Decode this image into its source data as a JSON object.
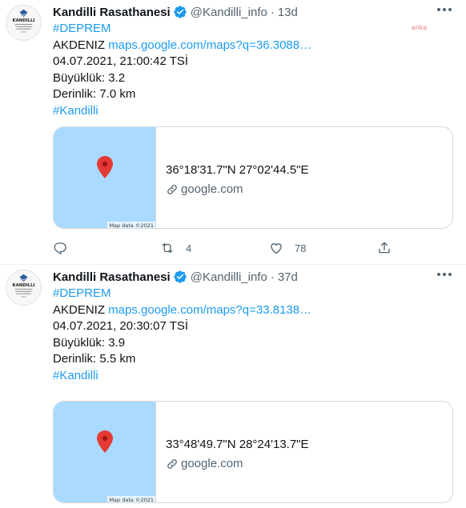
{
  "tweets": [
    {
      "account": {
        "name": "Kandilli Rasathanesi",
        "handle": "@Kandilli_info",
        "separator": "·",
        "time": "13d",
        "avatar_text": "KANDILLI"
      },
      "watermark": "anka",
      "lines": {
        "hashtag1": "#DEPREM",
        "region": "AKDENIZ",
        "map_link": "maps.google.com/maps?q=36.3088…",
        "datetime": "04.07.2021, 21:00:42 TSİ",
        "magnitude": "Büyüklük: 3.2",
        "depth": "Derinlik: 7.0 km",
        "hashtag2": "#Kandilli"
      },
      "card": {
        "coords": "36°18'31.7\"N 27°02'44.5\"E",
        "domain": "google.com",
        "map_credit": "Map data ©2021"
      },
      "actions": {
        "reply_count": "",
        "retweet_count": "4",
        "like_count": "78"
      }
    },
    {
      "account": {
        "name": "Kandilli Rasathanesi",
        "handle": "@Kandilli_info",
        "separator": "·",
        "time": "37d",
        "avatar_text": "KANDILLI"
      },
      "lines": {
        "hashtag1": "#DEPREM",
        "region": "AKDENIZ",
        "map_link": "maps.google.com/maps?q=33.8138…",
        "datetime": "04.07.2021, 20:30:07 TSİ",
        "magnitude": "Büyüklük: 3.9",
        "depth": "Derinlik: 5.5 km",
        "hashtag2": "#Kandilli"
      },
      "card": {
        "coords": "33°48'49.7\"N 28°24'13.7\"E",
        "domain": "google.com",
        "map_credit": "Map data ©2021"
      }
    }
  ],
  "colors": {
    "accent": "#1d9bf0",
    "muted": "#536471",
    "map_water": "#aadaff",
    "pin": "#e53935"
  },
  "icons": [
    "verified-badge-icon",
    "more-icon",
    "map-pin-icon",
    "link-icon",
    "reply-icon",
    "retweet-icon",
    "like-icon",
    "share-icon"
  ]
}
